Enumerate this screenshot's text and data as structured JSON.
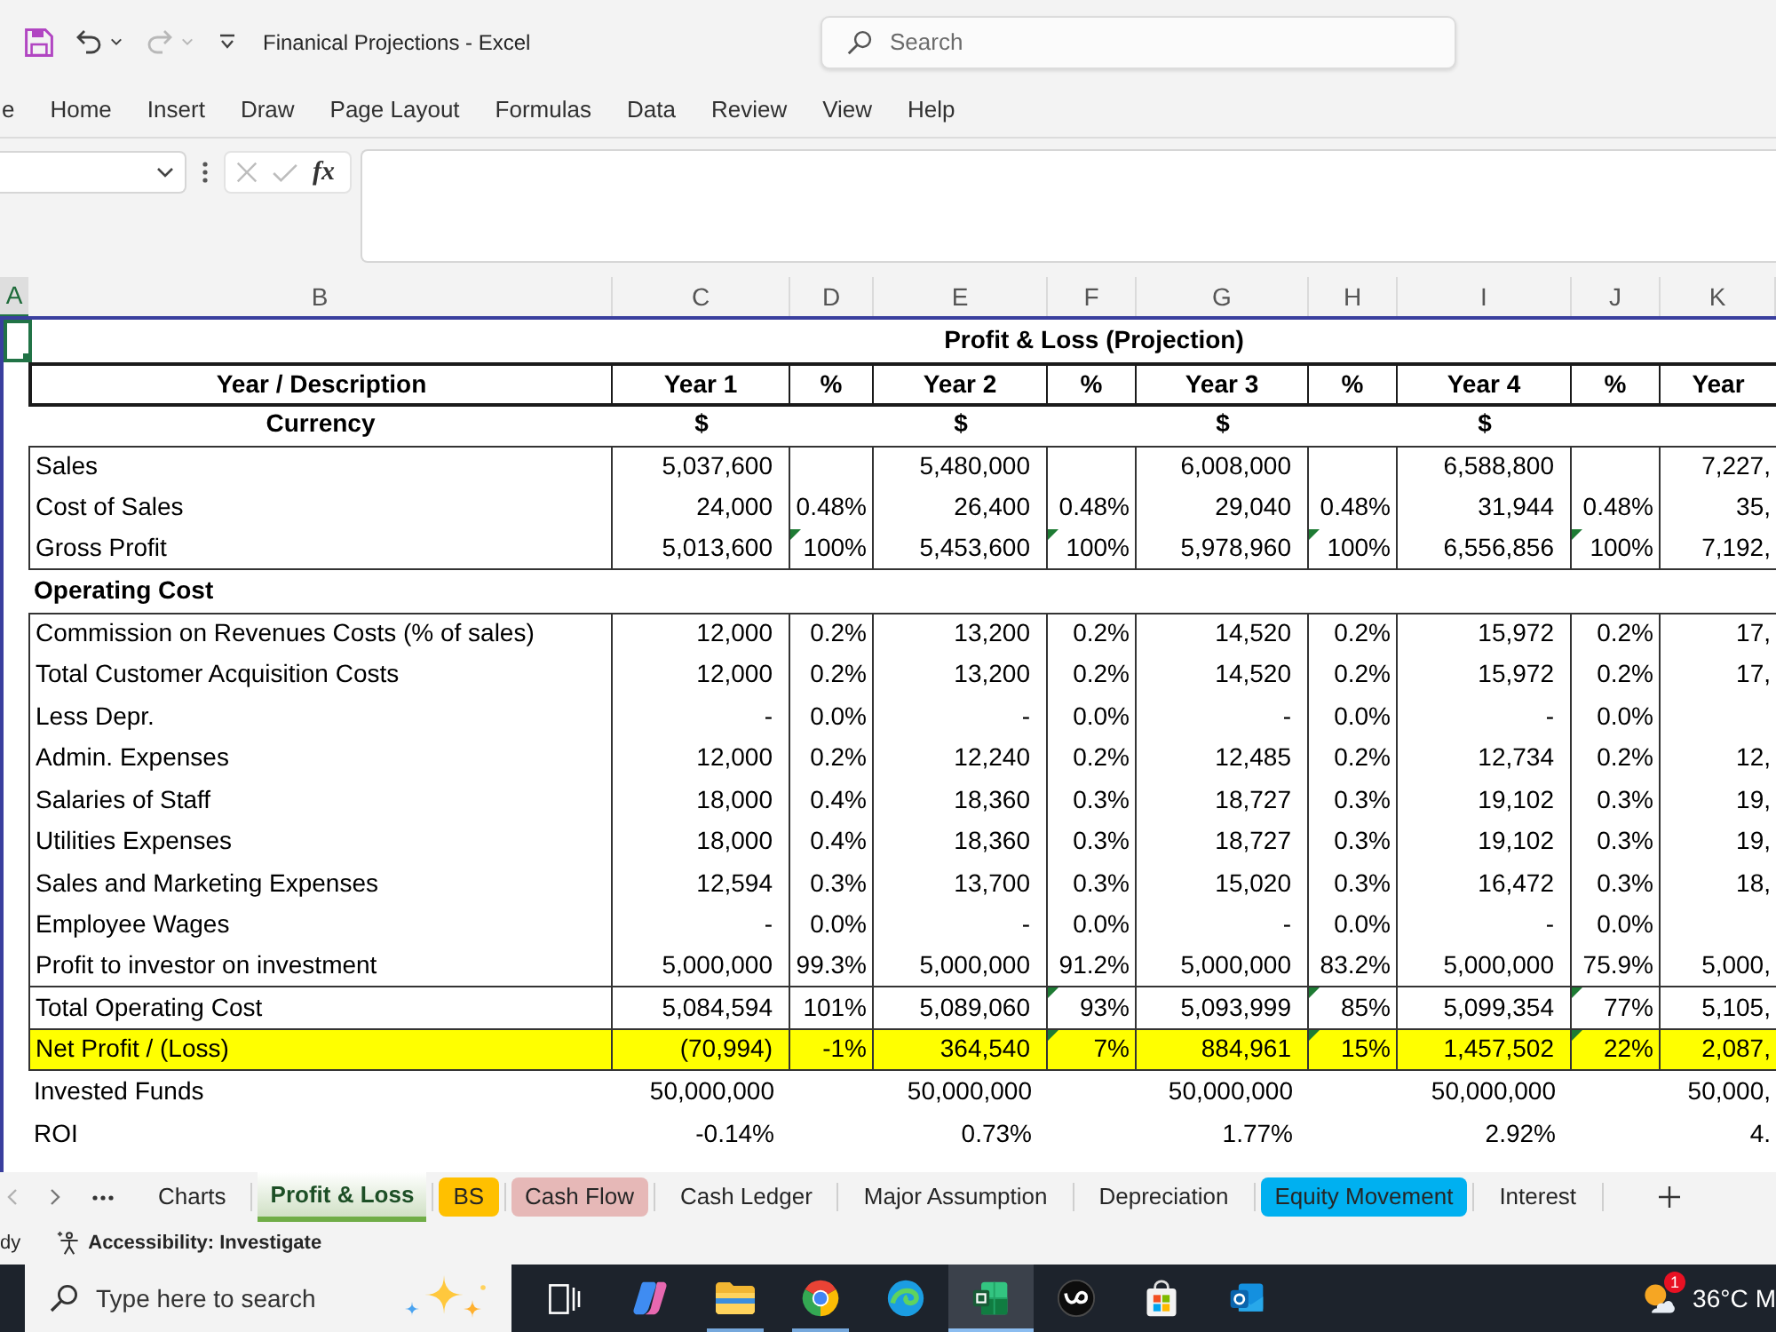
{
  "title_bar": {
    "quick_access": [
      {
        "kind": "save",
        "disabled": false
      },
      {
        "kind": "undo",
        "disabled": false
      },
      {
        "kind": "redo",
        "disabled": true
      },
      {
        "kind": "customize",
        "disabled": false
      }
    ],
    "document_title": "Finanical Projections - Excel",
    "search": {
      "placeholder": "Search"
    }
  },
  "ribbon_tabs": [
    {
      "label": "e",
      "selected": false
    },
    {
      "label": "Home",
      "selected": false
    },
    {
      "label": "Insert",
      "selected": false
    },
    {
      "label": "Draw",
      "selected": false
    },
    {
      "label": "Page Layout",
      "selected": false
    },
    {
      "label": "Formulas",
      "selected": false
    },
    {
      "label": "Data",
      "selected": false
    },
    {
      "label": "Review",
      "selected": false
    },
    {
      "label": "View",
      "selected": false
    },
    {
      "label": "Help",
      "selected": false
    }
  ],
  "formula_bar": {
    "buttons": [
      {
        "kind": "cancel",
        "disabled": true
      },
      {
        "kind": "enter",
        "disabled": true
      },
      {
        "kind": "function",
        "label": "fx",
        "disabled": false
      }
    ]
  },
  "column_headers": [
    {
      "label": "A",
      "selected": true
    },
    {
      "label": "B",
      "selected": false
    },
    {
      "label": "C",
      "selected": false
    },
    {
      "label": "D",
      "selected": false
    },
    {
      "label": "E",
      "selected": false
    },
    {
      "label": "F",
      "selected": false
    },
    {
      "label": "G",
      "selected": false
    },
    {
      "label": "H",
      "selected": false
    },
    {
      "label": "I",
      "selected": false
    },
    {
      "label": "J",
      "selected": false
    },
    {
      "label": "K",
      "selected": false
    }
  ],
  "sheet": {
    "title": "Profit & Loss (Projection)",
    "blocks": [
      {
        "kind": "header",
        "rows": [
          {
            "label": "Year / Description",
            "cells": [
              "Year 1",
              "%",
              "Year 2",
              "%",
              "Year 3",
              "%",
              "Year 4",
              "%",
              "Year"
            ]
          }
        ]
      },
      {
        "kind": "unit",
        "rows": [
          {
            "label": "Currency",
            "cells": [
              "$",
              null,
              "$",
              null,
              "$",
              null,
              "$",
              null,
              null
            ]
          }
        ]
      },
      {
        "kind": "boxed",
        "rows": [
          {
            "label": "Sales",
            "cells": [
              "5,037,600",
              null,
              "5,480,000",
              null,
              "6,008,000",
              null,
              "6,588,800",
              null,
              "7,227,"
            ]
          },
          {
            "label": "Cost of Sales",
            "cells": [
              "24,000",
              "0.48%",
              "26,400",
              "0.48%",
              "29,040",
              "0.48%",
              "31,944",
              "0.48%",
              "35,"
            ]
          },
          {
            "label": "Gross Profit",
            "cells": [
              "5,013,600",
              "100%",
              "5,453,600",
              "100%",
              "5,978,960",
              "100%",
              "6,556,856",
              "100%",
              "7,192,"
            ],
            "flags": [
              false,
              true,
              false,
              true,
              false,
              true,
              false,
              true,
              false
            ]
          }
        ]
      },
      {
        "kind": "section",
        "rows": [
          {
            "label": "Operating Cost"
          }
        ]
      },
      {
        "kind": "boxed",
        "rows": [
          {
            "label": "Commission on Revenues Costs (% of sales)",
            "cells": [
              "12,000",
              "0.2%",
              "13,200",
              "0.2%",
              "14,520",
              "0.2%",
              "15,972",
              "0.2%",
              "17,"
            ]
          },
          {
            "label": "Total Customer Acquisition Costs",
            "cells": [
              "12,000",
              "0.2%",
              "13,200",
              "0.2%",
              "14,520",
              "0.2%",
              "15,972",
              "0.2%",
              "17,"
            ]
          },
          {
            "label": "Less Depr.",
            "cells": [
              "-",
              "0.0%",
              "-",
              "0.0%",
              "-",
              "0.0%",
              "-",
              "0.0%",
              null
            ]
          },
          {
            "label": "Admin. Expenses",
            "cells": [
              "12,000",
              "0.2%",
              "12,240",
              "0.2%",
              "12,485",
              "0.2%",
              "12,734",
              "0.2%",
              "12,"
            ]
          },
          {
            "label": "Salaries of Staff",
            "cells": [
              "18,000",
              "0.4%",
              "18,360",
              "0.3%",
              "18,727",
              "0.3%",
              "19,102",
              "0.3%",
              "19,"
            ]
          },
          {
            "label": "Utilities Expenses",
            "cells": [
              "18,000",
              "0.4%",
              "18,360",
              "0.3%",
              "18,727",
              "0.3%",
              "19,102",
              "0.3%",
              "19,"
            ]
          },
          {
            "label": "Sales and Marketing Expenses",
            "cells": [
              "12,594",
              "0.3%",
              "13,700",
              "0.3%",
              "15,020",
              "0.3%",
              "16,472",
              "0.3%",
              "18,"
            ]
          },
          {
            "label": "Employee Wages",
            "cells": [
              "-",
              "0.0%",
              "-",
              "0.0%",
              "-",
              "0.0%",
              "-",
              "0.0%",
              null
            ]
          },
          {
            "label": "Profit to investor on investment",
            "cells": [
              "5,000,000",
              "99.3%",
              "5,000,000",
              "91.2%",
              "5,000,000",
              "83.2%",
              "5,000,000",
              "75.9%",
              "5,000,"
            ]
          }
        ]
      },
      {
        "kind": "boxed",
        "rows": [
          {
            "label": "Total Operating Cost",
            "cells": [
              "5,084,594",
              "101%",
              "5,089,060",
              "93%",
              "5,093,999",
              "85%",
              "5,099,354",
              "77%",
              "5,105,"
            ],
            "flags": [
              false,
              false,
              false,
              true,
              false,
              true,
              false,
              true,
              false
            ]
          }
        ]
      },
      {
        "kind": "highlight",
        "rows": [
          {
            "label": "Net Profit / (Loss)",
            "cells": [
              "(70,994)",
              "-1%",
              "364,540",
              "7%",
              "884,961",
              "15%",
              "1,457,502",
              "22%",
              "2,087,"
            ],
            "flags": [
              false,
              false,
              false,
              true,
              false,
              true,
              false,
              true,
              false
            ]
          }
        ]
      },
      {
        "kind": "plain",
        "rows": [
          {
            "label": "Invested Funds",
            "cells": [
              "50,000,000",
              null,
              "50,000,000",
              null,
              "50,000,000",
              null,
              "50,000,000",
              null,
              "50,000,"
            ]
          },
          {
            "label": "ROI",
            "cells": [
              "-0.14%",
              null,
              "0.73%",
              null,
              "1.77%",
              null,
              "2.92%",
              null,
              "4."
            ]
          }
        ]
      }
    ]
  },
  "sheet_tabs": [
    {
      "label": "Charts",
      "selected": false
    },
    {
      "label": "Profit & Loss",
      "selected": true,
      "color": "#70ad47"
    },
    {
      "label": "BS",
      "selected": false,
      "color": "#ffc000"
    },
    {
      "label": "Cash Flow",
      "selected": false,
      "color": "#e6b8b7"
    },
    {
      "label": "Cash Ledger",
      "selected": false
    },
    {
      "label": "Major Assumption",
      "selected": false
    },
    {
      "label": "Depreciation",
      "selected": false
    },
    {
      "label": "Equity Movement",
      "selected": false,
      "color": "#00b0f0"
    },
    {
      "label": "Interest",
      "selected": false
    }
  ],
  "status_bar": {
    "mode": "dy",
    "accessibility": "Accessibility: Investigate"
  },
  "taskbar": {
    "search": {
      "placeholder": "Type here to search"
    },
    "apps": [
      {
        "kind": "task_view",
        "running": false,
        "selected": false
      },
      {
        "kind": "copilot",
        "running": false,
        "selected": false
      },
      {
        "kind": "explorer",
        "running": true,
        "selected": false
      },
      {
        "kind": "chrome",
        "running": true,
        "selected": false
      },
      {
        "kind": "edge",
        "running": false,
        "selected": false
      },
      {
        "kind": "excel",
        "running": true,
        "selected": true
      },
      {
        "kind": "upwork",
        "running": false,
        "selected": false
      },
      {
        "kind": "store",
        "running": false,
        "selected": false
      },
      {
        "kind": "outlook",
        "running": false,
        "selected": false
      }
    ],
    "weather": {
      "badge": "1",
      "temperature": "36°C",
      "condition": "M"
    }
  }
}
